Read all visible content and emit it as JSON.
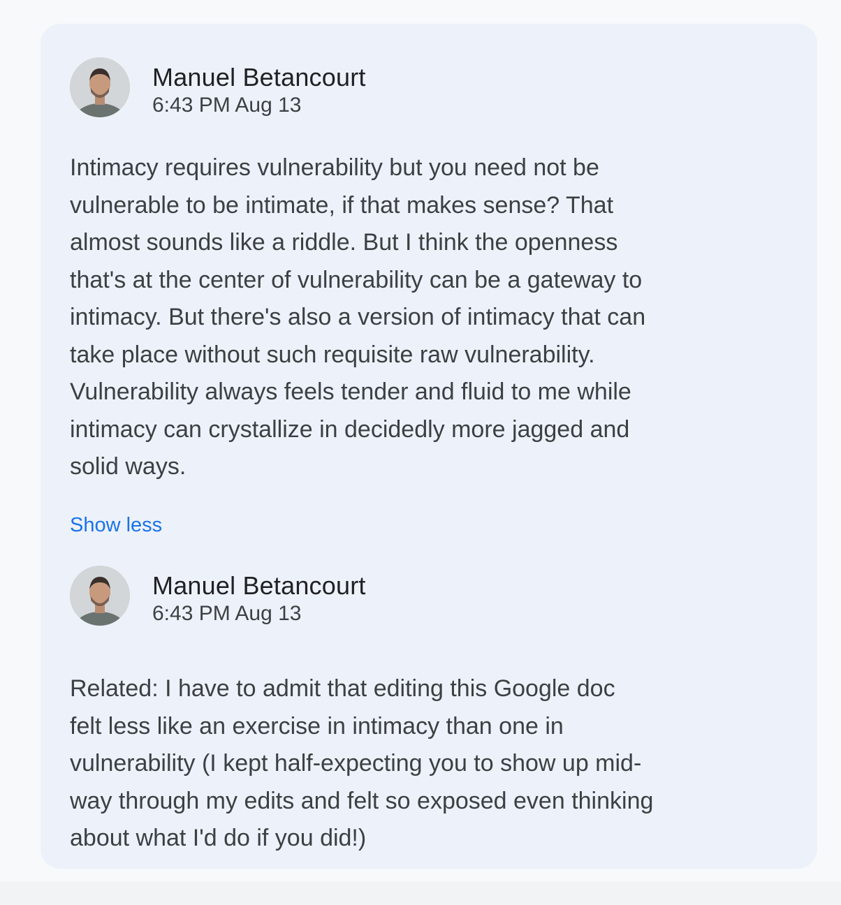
{
  "comments": [
    {
      "author": "Manuel Betancourt",
      "timestamp": "6:43 PM Aug 13",
      "avatar_icon": "user-avatar",
      "body_lines": [
        "Intimacy requires vulnerability but you need not be",
        "vulnerable to be intimate, if that makes sense? That",
        "almost sounds like a riddle. But I think the openness",
        "that's at the center of vulnerability can be a gateway to",
        "intimacy. But there's also a version of intimacy that can",
        "take place without such requisite raw vulnerability.",
        "Vulnerability always feels tender and fluid to me while",
        "intimacy can crystallize in decidedly more jagged and",
        "solid ways."
      ],
      "toggle_label": "Show less"
    },
    {
      "author": "Manuel Betancourt",
      "timestamp": "6:43 PM Aug 13",
      "avatar_icon": "user-avatar",
      "body_lines": [
        "Related: I have to admit that editing this Google doc",
        "felt less like an exercise in intimacy than one in",
        "vulnerability (I kept half-expecting you to show up mid-",
        "way through my edits and felt so exposed even thinking",
        "about what I'd do if you did!)"
      ]
    }
  ],
  "colors": {
    "card_background": "#edf2fa",
    "link": "#1a73e8",
    "author_text": "#202124",
    "body_text": "#3c4043"
  }
}
